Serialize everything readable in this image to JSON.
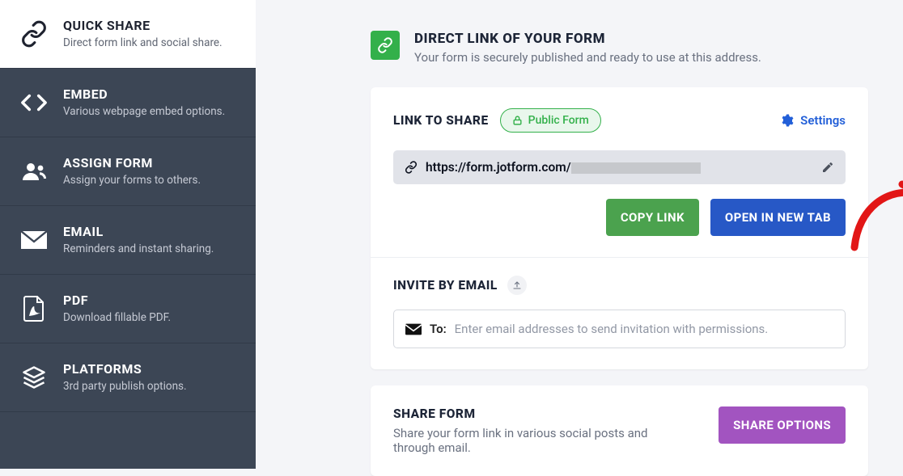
{
  "sidebar": {
    "items": [
      {
        "title": "QUICK SHARE",
        "subtitle": "Direct form link and social share."
      },
      {
        "title": "EMBED",
        "subtitle": "Various webpage embed options."
      },
      {
        "title": "ASSIGN FORM",
        "subtitle": "Assign your forms to others."
      },
      {
        "title": "EMAIL",
        "subtitle": "Reminders and instant sharing."
      },
      {
        "title": "PDF",
        "subtitle": "Download fillable PDF."
      },
      {
        "title": "PLATFORMS",
        "subtitle": "3rd party publish options."
      }
    ]
  },
  "hero": {
    "title": "DIRECT LINK OF YOUR FORM",
    "subtitle": "Your form is securely published and ready to use at this address."
  },
  "link_card": {
    "section_title": "LINK TO SHARE",
    "badge_label": "Public Form",
    "settings_label": "Settings",
    "url": "https://form.jotform.com/",
    "copy_label": "COPY LINK",
    "open_label": "OPEN IN NEW TAB"
  },
  "invite": {
    "title": "INVITE BY EMAIL",
    "to_label": "To:",
    "placeholder": "Enter email addresses to send invitation with permissions."
  },
  "share_card": {
    "title": "SHARE FORM",
    "subtitle": "Share your form link in various social posts and through email.",
    "button_label": "SHARE OPTIONS"
  }
}
